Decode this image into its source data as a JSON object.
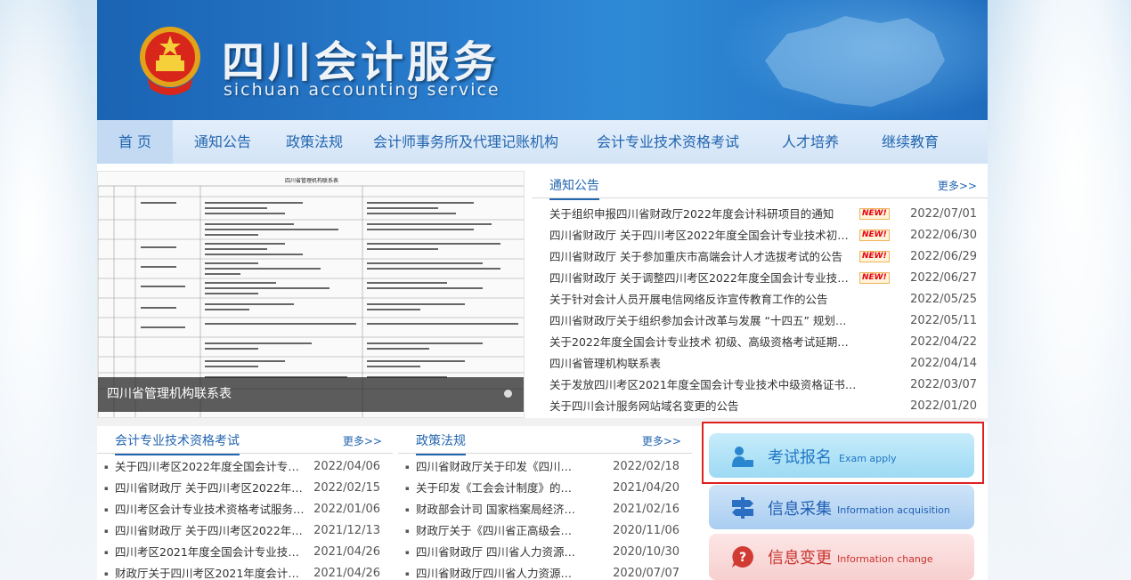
{
  "header": {
    "title": "四川会计服务",
    "subtitle": "sichuan accounting service"
  },
  "nav": {
    "items": [
      "首 页",
      "通知公告",
      "政策法规",
      "会计师事务所及代理记账机构",
      "会计专业技术资格考试",
      "人才培养",
      "继续教育"
    ]
  },
  "slider": {
    "caption": "四川省管理机构联系表",
    "doc_title": "四川省管理机构联系表"
  },
  "notice": {
    "title": "通知公告",
    "more": "更多>>",
    "new_label": "NEW!",
    "items": [
      {
        "title": "关于组织申报四川省财政厅2022年度会计科研项目的通知",
        "date": "2022/07/01",
        "new": true
      },
      {
        "title": "四川省财政厅 关于四川考区2022年度全国会计专业技术初级、高级…",
        "date": "2022/06/30",
        "new": true
      },
      {
        "title": "四川省财政厅 关于参加重庆市高端会计人才选拔考试的公告",
        "date": "2022/06/29",
        "new": true
      },
      {
        "title": "四川省财政厅 关于调整四川考区2022年度全国会计专业技术初…",
        "date": "2022/06/27",
        "new": true
      },
      {
        "title": "关于针对会计人员开展电信网络反诈宣传教育工作的公告",
        "date": "2022/05/25",
        "new": false
      },
      {
        "title": "四川省财政厅关于组织参加会计改革与发展 “十四五” 规划网…",
        "date": "2022/05/11",
        "new": false
      },
      {
        "title": "关于2022年度全国会计专业技术 初级、高级资格考试延期举行…",
        "date": "2022/04/22",
        "new": false
      },
      {
        "title": "四川省管理机构联系表",
        "date": "2022/04/14",
        "new": false
      },
      {
        "title": "关于发放四川考区2021年度全国会计专业技术中级资格证书的…",
        "date": "2022/03/07",
        "new": false
      },
      {
        "title": "关于四川会计服务网站域名变更的公告",
        "date": "2022/01/20",
        "new": false
      }
    ]
  },
  "exam": {
    "title": "会计专业技术资格考试",
    "more": "更多>>",
    "items": [
      {
        "title": "关于四川考区2022年度全国会计专业…",
        "date": "2022/04/06"
      },
      {
        "title": "四川省财政厅 关于四川考区2022年度…",
        "date": "2022/02/15"
      },
      {
        "title": "四川考区会计专业技术资格考试服务事…",
        "date": "2022/01/06"
      },
      {
        "title": "四川省财政厅 关于四川考区2022年度…",
        "date": "2021/12/13"
      },
      {
        "title": "四川考区2021年度全国会计专业技术…",
        "date": "2021/04/26"
      },
      {
        "title": "财政厅关于四川考区2021年度会计初…",
        "date": "2021/04/26"
      }
    ]
  },
  "law": {
    "title": "政策法规",
    "more": "更多>>",
    "items": [
      {
        "title": "四川省财政厅关于印发《四川省…",
        "date": "2022/02/18"
      },
      {
        "title": "关于印发《工会会计制度》的通知",
        "date": "2021/04/20"
      },
      {
        "title": "财政部会计司 国家档案局经济科…",
        "date": "2021/02/16"
      },
      {
        "title": "财政厅关于《四川省正高级会计…",
        "date": "2020/11/06"
      },
      {
        "title": "四川省财政厅 四川省人力资源和…",
        "date": "2020/10/30"
      },
      {
        "title": "四川省财政厅四川省人力资源和…",
        "date": "2020/07/07"
      }
    ]
  },
  "quick": {
    "exam_apply": {
      "cn": "考试报名",
      "en": "Exam apply"
    },
    "info_acquisition": {
      "cn": "信息采集",
      "en": "Information acquisition"
    },
    "info_change": {
      "cn": "信息变更",
      "en": "Information change"
    }
  },
  "colors": {
    "brand_blue": "#2366b0",
    "highlight_red": "#e0201f"
  }
}
